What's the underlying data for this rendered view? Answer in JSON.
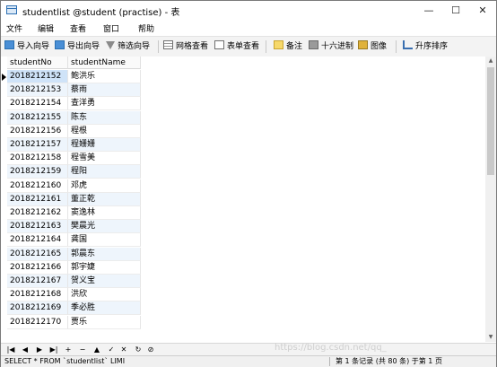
{
  "window": {
    "title": "studentlist @student (practise) - 表",
    "minimize": "—",
    "maximize": "☐",
    "close": "✕"
  },
  "menu": [
    "文件",
    "编辑",
    "查看",
    "窗口",
    "帮助"
  ],
  "toolbar": {
    "import_wizard": "导入向导",
    "export_wizard": "导出向导",
    "filter_wizard": "筛选向导",
    "grid_view": "网格查看",
    "form_view": "表单查看",
    "memo": "备注",
    "hex": "十六进制",
    "image": "图像",
    "sort_asc": "升序排序"
  },
  "grid": {
    "columns": [
      "studentNo",
      "studentName"
    ],
    "rows": [
      [
        "2018212152",
        "鲍洪乐"
      ],
      [
        "2018212153",
        "蔡雨"
      ],
      [
        "2018212154",
        "查洋勇"
      ],
      [
        "2018212155",
        "陈东"
      ],
      [
        "2018212156",
        "程根"
      ],
      [
        "2018212157",
        "程姗姗"
      ],
      [
        "2018212158",
        "程雪美"
      ],
      [
        "2018212159",
        "程阳"
      ],
      [
        "2018212160",
        "邓虎"
      ],
      [
        "2018212161",
        "董正乾"
      ],
      [
        "2018212162",
        "窦逸林"
      ],
      [
        "2018212163",
        "樊晨光"
      ],
      [
        "2018212164",
        "龚国"
      ],
      [
        "2018212165",
        "郭晨东"
      ],
      [
        "2018212166",
        "郭宇婕"
      ],
      [
        "2018212167",
        "贺义宝"
      ],
      [
        "2018212168",
        "洪欣"
      ],
      [
        "2018212169",
        "季必胜"
      ],
      [
        "2018212170",
        "贾乐"
      ]
    ]
  },
  "navigator": [
    "|◀",
    "◀",
    "▶",
    "▶|",
    "+",
    "−",
    "▲",
    "✓",
    "✕",
    "↻",
    "⊘"
  ],
  "status": {
    "sql": "SELECT * FROM `studentlist` LIMI",
    "records": "第 1 条记录 (共 80 条) 于第 1 页"
  },
  "watermark": "https://blog.csdn.net/qq_"
}
